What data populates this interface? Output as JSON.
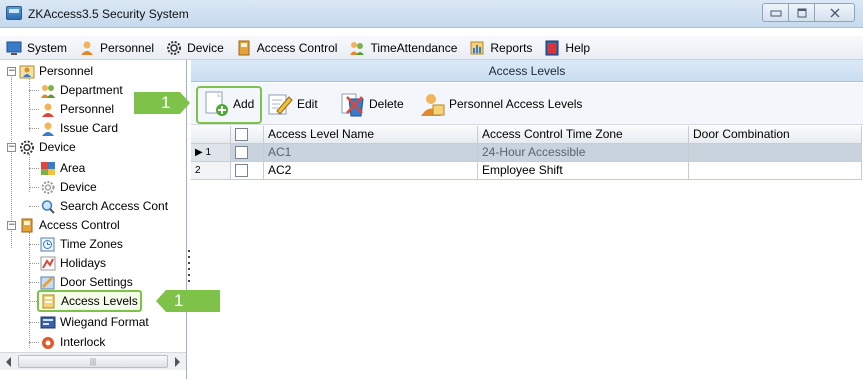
{
  "window": {
    "title": "ZKAccess3.5 Security System",
    "controls": {
      "minimize": "▭",
      "maximize": "▣",
      "close": "✕"
    }
  },
  "menu": [
    {
      "label": "System",
      "icon": "system-icon"
    },
    {
      "label": "Personnel",
      "icon": "personnel-icon"
    },
    {
      "label": "Device",
      "icon": "gear-icon"
    },
    {
      "label": "Access Control",
      "icon": "access-control-icon"
    },
    {
      "label": "TimeAttendance",
      "icon": "time-attendance-icon"
    },
    {
      "label": "Reports",
      "icon": "reports-icon"
    },
    {
      "label": "Help",
      "icon": "help-icon"
    }
  ],
  "tree": {
    "personnel": {
      "label": "Personnel",
      "children": [
        "Department",
        "Personnel",
        "Issue Card"
      ]
    },
    "device": {
      "label": "Device",
      "children": [
        "Area",
        "Device",
        "Search Access Cont"
      ]
    },
    "access_control": {
      "label": "Access Control",
      "children": [
        "Time Zones",
        "Holidays",
        "Door Settings",
        "Access Levels",
        "Wiegand Format",
        "Interlock"
      ]
    },
    "selected": "Access Levels",
    "scroll_thumb": "|||"
  },
  "panel": {
    "title": "Access Levels",
    "toolbar": {
      "add": "Add",
      "edit": "Edit",
      "delete": "Delete",
      "personnel_access_levels": "Personnel Access Levels"
    }
  },
  "grid": {
    "columns": [
      "Access Level Name",
      "Access Control Time Zone",
      "Door Combination"
    ],
    "rows": [
      {
        "num": "1",
        "marker": "▶",
        "name": "AC1",
        "time_zone": "24-Hour Accessible",
        "doors": ""
      },
      {
        "num": "2",
        "marker": "",
        "name": "AC2",
        "time_zone": "Employee Shift",
        "doors": ""
      }
    ]
  },
  "callouts": {
    "toolbar_step": "1",
    "tree_step": "1"
  },
  "colors": {
    "highlight": "#7ec24a",
    "header_blue": "#c9ddf2",
    "selected_row": "#c9d3de"
  }
}
